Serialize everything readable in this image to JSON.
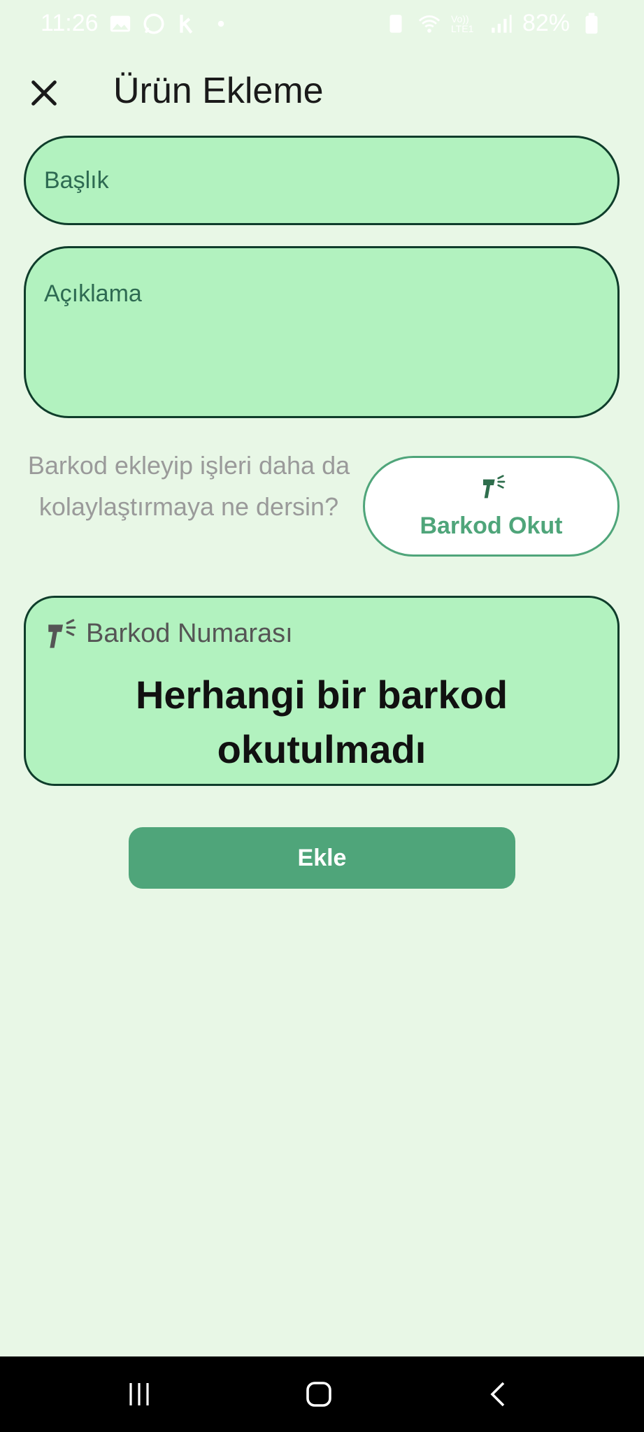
{
  "status_bar": {
    "time": "11:26",
    "network_label": "Vo)) LTE1",
    "battery": "82%"
  },
  "header": {
    "title": "Ürün Ekleme",
    "close_icon": "close-icon"
  },
  "form": {
    "title_placeholder": "Başlık",
    "description_placeholder": "Açıklama"
  },
  "barcode": {
    "promo_text": "Barkod ekleyip işleri daha da kolaylaştırmaya ne dersin?",
    "scan_button_label": "Barkod Okut",
    "card_label": "Barkod Numarası",
    "card_value": "Herhangi bir barkod okutulmadı"
  },
  "actions": {
    "add_label": "Ekle"
  },
  "colors": {
    "background": "#E8F7E6",
    "field_fill": "#B2F2BF",
    "field_border": "#0F3D2B",
    "accent": "#4FA57A"
  }
}
